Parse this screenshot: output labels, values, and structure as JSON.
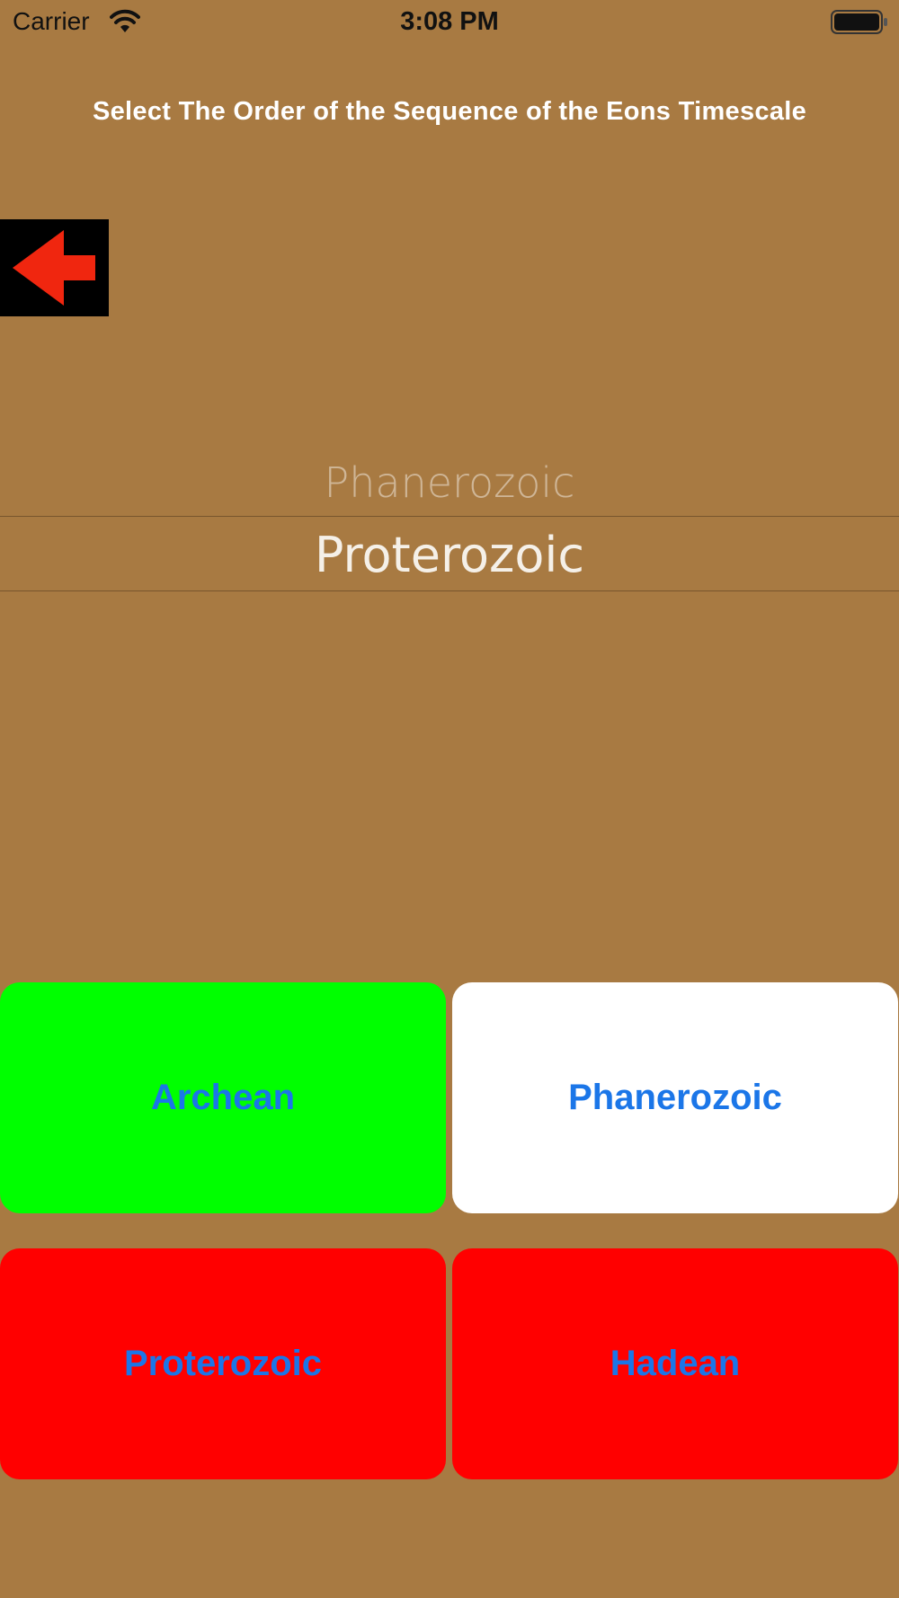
{
  "status_bar": {
    "carrier": "Carrier",
    "time": "3:08 PM",
    "wifi_icon": "wifi-icon",
    "battery_icon": "battery-icon"
  },
  "title": "Select The Order of the Sequence of the Eons Timescale",
  "back_button": {
    "icon": "left-arrow-icon",
    "arrow_color": "#f0260f",
    "background_color": "#000000"
  },
  "picker": {
    "items": [
      "Phanerozoic",
      "Proterozoic"
    ],
    "selected": "Proterozoic"
  },
  "answers": [
    {
      "label": "Archean",
      "background": "#00ff00"
    },
    {
      "label": "Phanerozoic",
      "background": "#ffffff"
    },
    {
      "label": "Proterozoic",
      "background": "#ff0000"
    },
    {
      "label": "Hadean",
      "background": "#ff0000"
    }
  ],
  "colors": {
    "background": "#a87a42",
    "button_text": "#1b76e8"
  }
}
